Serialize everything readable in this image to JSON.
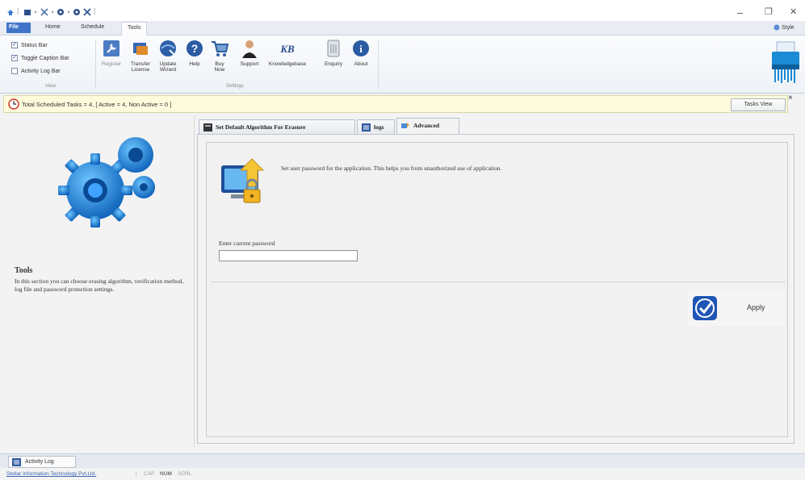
{
  "window": {
    "minimize": "–",
    "restore": "❐",
    "close": "✕"
  },
  "quick_access": {
    "separator": "|"
  },
  "tabs": {
    "file": "File",
    "home": "Home",
    "schedule": "Schedule",
    "tools": "Tools",
    "style": "Style"
  },
  "ribbon": {
    "view_group": {
      "label": "View",
      "items": [
        {
          "label": "Status Bar",
          "checked": true
        },
        {
          "label": "Toggle Caption Bar",
          "checked": true
        },
        {
          "label": "Activity Log Bar",
          "checked": false
        }
      ]
    },
    "settings_group": {
      "label": "Settings",
      "buttons": [
        {
          "label": "Register",
          "icon": "key-icon"
        },
        {
          "label": "Transfer License",
          "icon": "transfer-icon"
        },
        {
          "label": "Update Wizard",
          "icon": "globe-update-icon"
        },
        {
          "label": "Help",
          "icon": "help-icon"
        },
        {
          "label": "Buy Now",
          "icon": "cart-icon"
        },
        {
          "label": "Support",
          "icon": "support-person-icon"
        },
        {
          "label": "Knowledgebase",
          "icon": "kb-icon"
        },
        {
          "label": "Enquiry",
          "icon": "enquiry-icon"
        },
        {
          "label": "About",
          "icon": "info-icon"
        }
      ]
    }
  },
  "infobar": {
    "text": "Total Scheduled Tasks = 4, [ Active = 4, Non Active = 0 ]",
    "tasks_view": "Tasks View",
    "close": "×"
  },
  "left_panel": {
    "title": "Tools",
    "description": "In this section you can choose erasing algorithm, verification method, log file and password protection settings."
  },
  "doc_tabs": [
    {
      "label": "Set Default Algorithm For Erasure",
      "icon": "algorithm-icon",
      "active": false
    },
    {
      "label": "logs",
      "icon": "logs-icon",
      "active": false
    },
    {
      "label": "Advanced",
      "icon": "advanced-icon",
      "active": true
    }
  ],
  "advanced": {
    "description": "Set user password for the application. This helps you from unauthorized use of application.",
    "password_label": "Enter current password",
    "password_value": "",
    "apply_label": "Apply"
  },
  "bottom": {
    "activity_log": "Activity Log"
  },
  "statusbar": {
    "company": "Stellar Information Technology Pvt.Ltd.",
    "cap": "CAP",
    "num": "NUM",
    "scrl": "SCRL"
  },
  "colors": {
    "accent": "#3f74c9",
    "infobar_bg": "#fdfbdc",
    "gear_blue": "#1e88e5"
  }
}
